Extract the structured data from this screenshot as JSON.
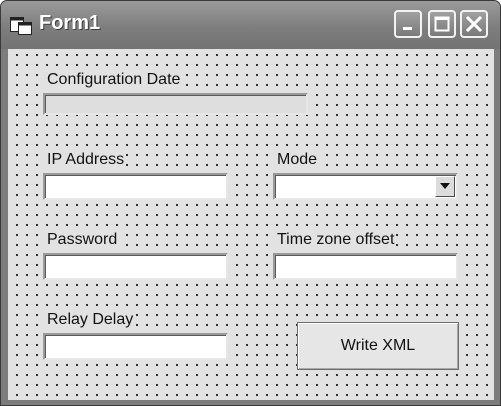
{
  "window": {
    "title": "Form1",
    "app_icon": "form-icon",
    "controls": [
      "minimize-icon",
      "maximize-icon",
      "close-icon"
    ]
  },
  "form": {
    "configuration_date": {
      "label": "Configuration  Date",
      "value": ""
    },
    "ip_address": {
      "label": "IP Address",
      "value": ""
    },
    "mode": {
      "label": "Mode",
      "value": "",
      "dropdown_icon": "chevron-down-icon"
    },
    "password": {
      "label": "Password",
      "value": ""
    },
    "time_zone_offset": {
      "label": "Time zone offset",
      "value": ""
    },
    "relay_delay": {
      "label": "Relay Delay",
      "value": ""
    },
    "write_xml_button": "Write XML"
  },
  "colors": {
    "titlebar": "#7e7e7e",
    "client_background": "#e2e2e2",
    "grid_dots": "#1e1e1e"
  }
}
